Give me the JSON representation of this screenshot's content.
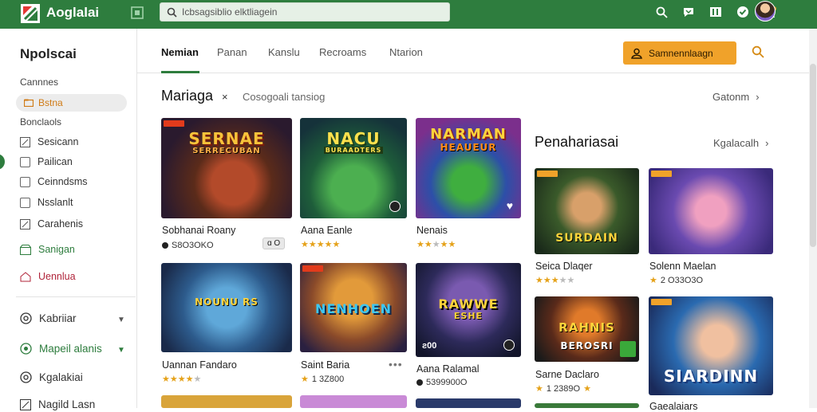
{
  "header": {
    "app_title": "Aoglalai",
    "search_placeholder": "Icbsagsiblio elktliagein"
  },
  "sidebar": {
    "title": "Npolscai",
    "section1": "Cannnes",
    "active_item": "Bstna",
    "section2": "Bonclaols",
    "items": [
      "Sesicann",
      "Pailican",
      "Ceinndsms",
      "Nsslanlt",
      "Carahenis",
      "Sanigan",
      "Uennlua"
    ],
    "lower_items": [
      "Kabriiar",
      "Mapeil alanis",
      "Kgalakiai",
      "Nagild Lasn"
    ]
  },
  "tabs": {
    "items": [
      "Nemian",
      "Panan",
      "Kanslu",
      "Recroams",
      "Ntarion"
    ],
    "cta_label": "Samnennlaagn"
  },
  "main": {
    "section_title": "Mariaga",
    "section_close": "×",
    "section_sub": "Cosogoali tansiog",
    "see_all": "Gatonm",
    "row1": [
      {
        "cover": "SERNAE",
        "cover_sub": "SERRECUBAN",
        "label": "Sobhanai Roany",
        "rating": "S8O3OKO",
        "tag": "ɑ O"
      },
      {
        "cover": "NACU",
        "cover_sub": "BURAADTERS",
        "label": "Aana Eanle"
      },
      {
        "cover": "NARMAN",
        "cover_sub": "HEAUEUR",
        "label": "Nenais"
      }
    ],
    "row2": [
      {
        "cover": "NOUNU RS",
        "label": "Uannan Fandaro"
      },
      {
        "cover": "NENHOEN",
        "label": "Saint Baria",
        "rating": "1 3Z800"
      },
      {
        "cover": "RAWWE",
        "cover_sub": "ESHE",
        "label": "Aana Ralamal",
        "tag_corner": "ƨ00",
        "rating": "5399900O"
      }
    ]
  },
  "side_section": {
    "title": "Penahariasai",
    "see_all": "Kgalacalh",
    "cards": [
      {
        "cover": "SURDAIN",
        "label": "Seica Dlaqer"
      },
      {
        "cover": "",
        "label": "Solenn Maelan",
        "rating": "2 O33O3O"
      },
      {
        "cover": "RAHNIS",
        "cover_sub": "BEROSRI",
        "label": "Sarne Daclaro",
        "rating": "1 2389O"
      },
      {
        "cover": "SIARDINN",
        "label": "Gaealaiars"
      }
    ]
  },
  "colors": {
    "brand_green": "#2e7d3e",
    "cta_orange": "#f0a22a",
    "star": "#e5a21a"
  }
}
